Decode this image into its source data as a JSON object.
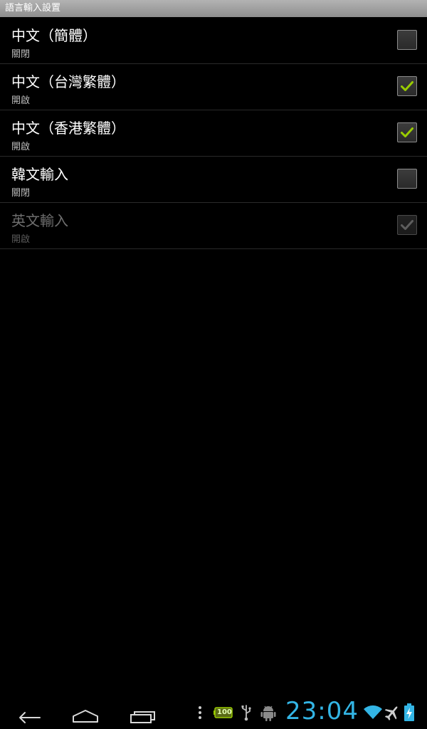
{
  "window": {
    "title": "語言輸入設置"
  },
  "languages": [
    {
      "title": "中文（簡體）",
      "summary": "關閉",
      "checked": false,
      "enabled": true
    },
    {
      "title": "中文（台灣繁體）",
      "summary": "開啟",
      "checked": true,
      "enabled": true
    },
    {
      "title": "中文（香港繁體）",
      "summary": "開啟",
      "checked": true,
      "enabled": true
    },
    {
      "title": "韓文輸入",
      "summary": "關閉",
      "checked": false,
      "enabled": true
    },
    {
      "title": "英文輸入",
      "summary": "開啟",
      "checked": true,
      "enabled": false
    }
  ],
  "nav": {
    "back_icon": "back-icon",
    "home_icon": "home-icon",
    "recent_icon": "recent-apps-icon"
  },
  "status": {
    "clock": "23:04",
    "battery_badge": "100",
    "accent_color": "#33b5e5",
    "check_color": "#99cc00"
  }
}
